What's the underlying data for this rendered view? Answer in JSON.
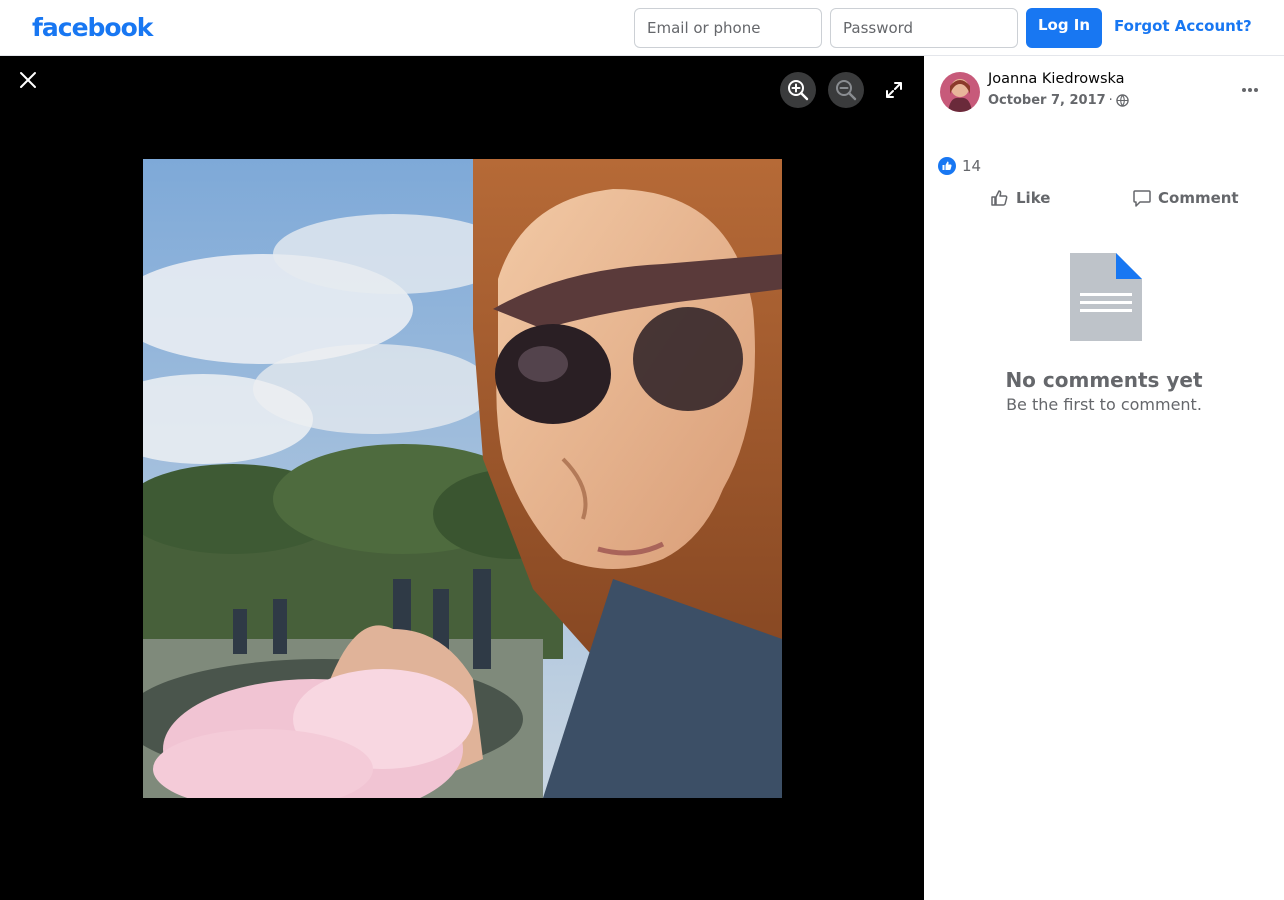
{
  "header": {
    "logo_text": "facebook",
    "email_placeholder": "Email or phone",
    "password_placeholder": "Password",
    "login_label": "Log In",
    "forgot_label": "Forgot Account?"
  },
  "viewer": {
    "photo_alt": "Photo of a woman wearing sunglasses holding pink cotton candy in a park"
  },
  "post": {
    "author": "Joanna Kiedrowska",
    "date": "October 7, 2017",
    "separator": "·",
    "privacy_icon": "globe-icon",
    "reaction_count": "14",
    "like_label": "Like",
    "comment_label": "Comment"
  },
  "comments": {
    "empty_title": "No comments yet",
    "empty_subtitle": "Be the first to comment."
  },
  "colors": {
    "brand": "#1877f2",
    "text_secondary": "#65676b",
    "viewer_bg": "#000000"
  }
}
